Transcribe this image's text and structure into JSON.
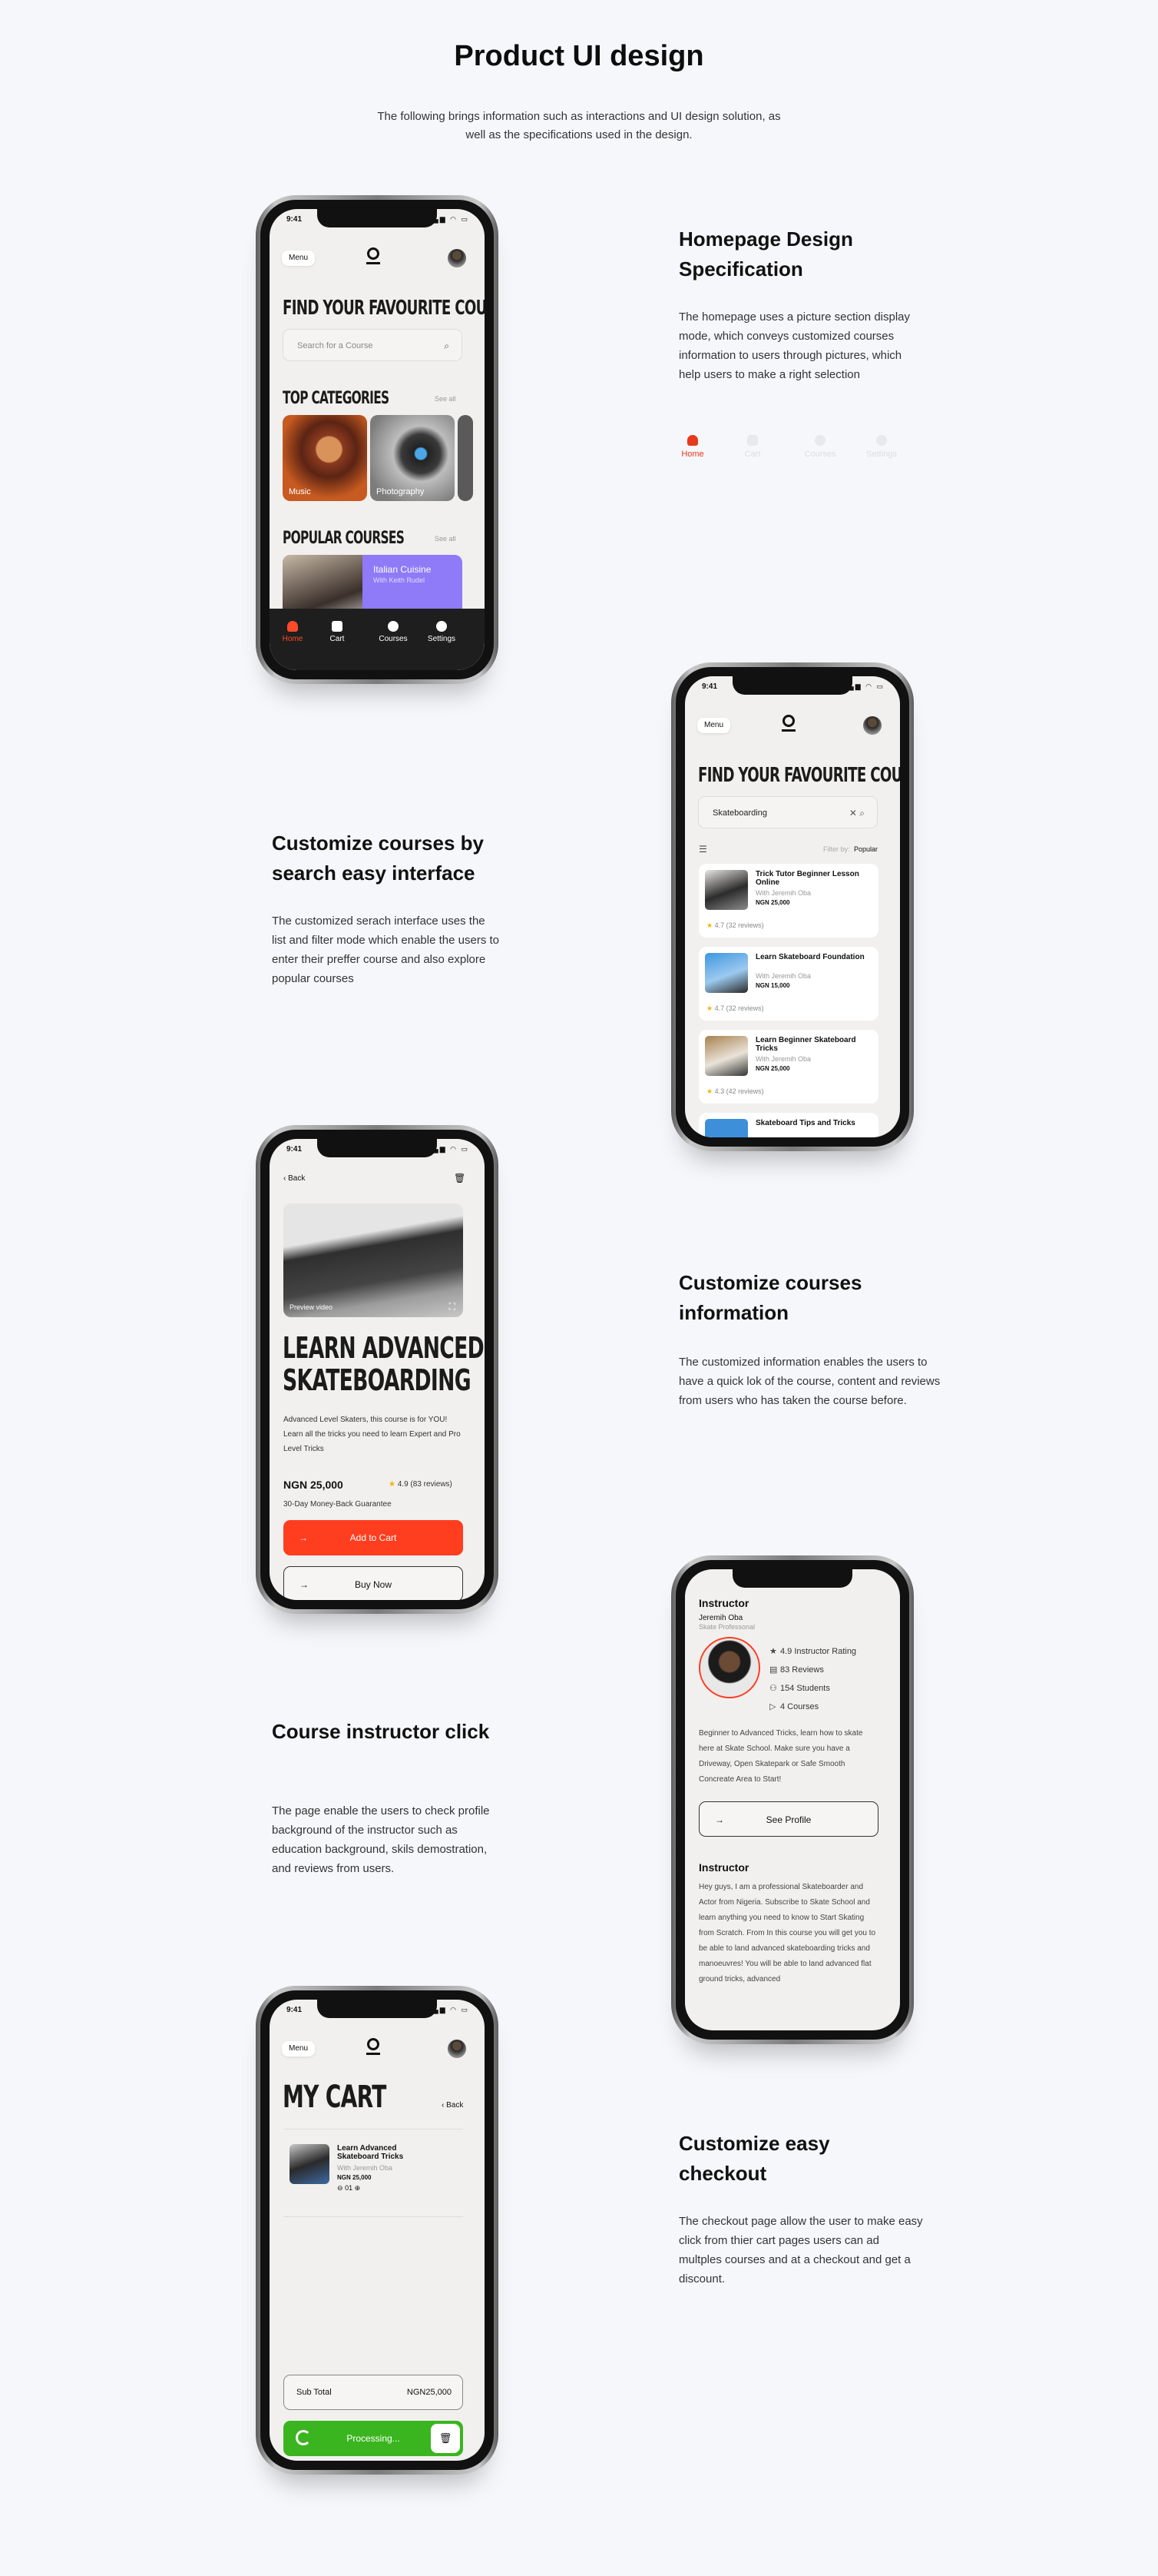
{
  "page": {
    "title": "Product UI design",
    "intro": "The following brings information such as interactions and UI design solution, as well as the specifications used in the design."
  },
  "sections": [
    {
      "heading": "Homepage Design Specification",
      "text": "The homepage uses a picture section display mode, which conveys customized courses information to users through pictures, which help users to make a right selection"
    },
    {
      "heading": "Customize courses by search easy interface",
      "text": "The customized serach interface uses the list and filter mode which enable the users to enter their preffer course and also explore popular courses"
    },
    {
      "heading": "Customize courses information",
      "text": "The customized information enables the users to have a quick lok of the course, content and reviews from users who has taken the course before."
    },
    {
      "heading": "Course instructor click",
      "text": "The page enable the users to check profile background of the instructor such as education background, skils demostration, and reviews from users."
    },
    {
      "heading": "Customize easy checkout",
      "text": "The checkout page allow the user to make easy click from thier cart pages users can ad multples courses and at a checkout and get a discount."
    }
  ],
  "nav_legend": [
    "Home",
    "Cart",
    "Courses",
    "Settings"
  ],
  "status": {
    "time": "9:41",
    "icons": "▂▄▆ ◠ ▭"
  },
  "common": {
    "menu": "Menu",
    "find_title": "FIND YOUR FAVOURITE COURSES"
  },
  "home": {
    "search_placeholder": "Search for a Course",
    "top_categories": "TOP CATEGORIES",
    "see_all": "See all",
    "categories": [
      "Music",
      "Photography"
    ],
    "popular_courses": "POPULAR COURSES",
    "popular_card": {
      "title": "Italian Cuisine",
      "by": "With Keith Rudel"
    },
    "nav": [
      "Home",
      "Cart",
      "Courses",
      "Settings"
    ]
  },
  "search": {
    "query": "Skateboarding",
    "filter_by": "Filter by:",
    "filter_value": "Popular",
    "results": [
      {
        "title": "Trick Tutor Beginner Lesson Online",
        "by": "With Jeremih Oba",
        "price": "NGN 25,000",
        "rating": "4.7 (32 reviews)"
      },
      {
        "title": "Learn Skateboard Foundation",
        "by": "With Jeremih Oba",
        "price": "NGN 15,000",
        "rating": "4.7 (32 reviews)"
      },
      {
        "title": "Learn Beginner Skateboard Tricks",
        "by": "With Jeremih Oba",
        "price": "NGN 25,000",
        "rating": "4.3 (42 reviews)"
      },
      {
        "title": "Skateboard Tips and Tricks"
      }
    ]
  },
  "detail": {
    "back": "Back",
    "preview": "Preview video",
    "title_line1": "LEARN ADVANCED",
    "title_line2": "SKATEBOARDING",
    "description": "Advanced Level Skaters, this course is for YOU! Learn all the tricks you need to learn Expert and Pro Level Tricks",
    "price": "NGN 25,000",
    "rating": "4.9 (83 reviews)",
    "guarantee": "30-Day Money-Back Guarantee",
    "add_to_cart": "Add to Cart",
    "buy_now": "Buy Now"
  },
  "instructor": {
    "heading": "Instructor",
    "name": "Jeremih Oba",
    "role": "Skate Professonal",
    "stats": [
      "4.9 Instructor Rating",
      "83 Reviews",
      "154 Students",
      "4 Courses"
    ],
    "bio": "Beginner to Advanced Tricks, learn how to skate here at Skate School. Make sure you have a Driveway, Open Skatepark or Safe Smooth Concreate Area to Start!",
    "see_profile": "See Profile",
    "heading2": "Instructor",
    "about": "Hey guys, I am a professional Skateboarder and Actor from Nigeria. Subscribe to Skate School and learn anything you need to know to Start Skating from Scratch. From In this course you will get you to be able to land advanced skateboarding tricks and manoeuvres! You will be able to land advanced flat ground tricks, advanced"
  },
  "cart": {
    "title": "MY CART",
    "back": "Back",
    "item": {
      "title": "Learn Advanced Skateboard Tricks",
      "by": "With Jeremih Oba",
      "price": "NGN 25,000",
      "qty": "01"
    },
    "subtotal_label": "Sub Total",
    "subtotal_value": "NGN25,000",
    "processing": "Processing..."
  },
  "colors": {
    "accent": "#ff3d1f",
    "green": "#3ab51f",
    "purple": "#8f7af8"
  }
}
